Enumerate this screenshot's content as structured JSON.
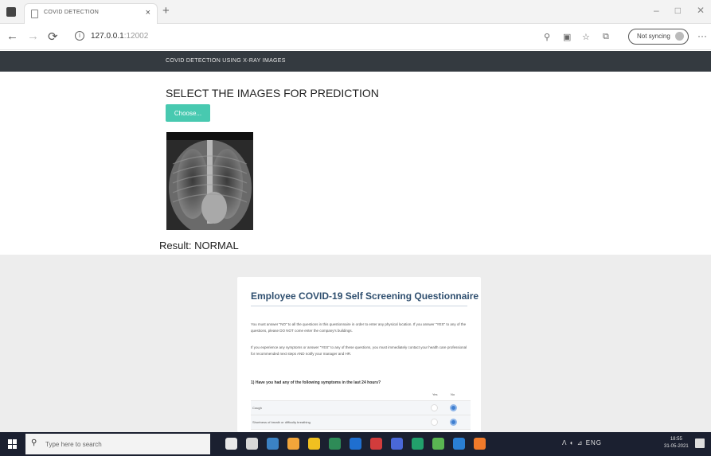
{
  "browser": {
    "tab_title": "COVID DETECTION",
    "tab_close": "×",
    "new_tab": "+",
    "url_host": "127.0.0.1",
    "url_port": ":12002",
    "sync_label": "Not syncing",
    "more": "···",
    "window_controls": [
      "–",
      "□",
      "✕"
    ]
  },
  "header": {
    "title": "COVID DETECTION USING X-RAY IMAGES"
  },
  "main": {
    "heading": "SELECT THE IMAGES FOR PREDICTION",
    "choose_label": "Choose...",
    "result": "Result: NORMAL"
  },
  "questionnaire": {
    "title": "Employee COVID-19 Self Screening Questionnaire",
    "para1": "You must answer \"NO\" to all the questions in this questionnaire in order to enter any physical location. If you answer \"YES\" to any of the questions, please DO NOT come enter the company's buildings.",
    "para2": "If you experience any symptoms or answer \"YES\" to any of these questions, you must immediately contact your health care professional for recommended next steps AND notify your manager and HR.",
    "question": "1) Have you had any of the following symptoms in the last 24 hours?",
    "col_yes": "Yes",
    "col_no": "No",
    "rows": [
      {
        "label": "Cough"
      },
      {
        "label": "Shortness of breath or difficulty breathing"
      }
    ]
  },
  "taskbar": {
    "search_placeholder": "Type here to search",
    "tray": "ENG",
    "clock_time": "18:55",
    "clock_date": "31-05-2021",
    "icon_colors": [
      "#e8e8e8",
      "#d8d8d8",
      "#3b82c4",
      "#f2a53a",
      "#f0c020",
      "#2e8b57",
      "#1f6fd0",
      "#d23c3c",
      "#4a68d8",
      "#22a06b",
      "#5ab552",
      "#2a7fd4",
      "#f07a2a"
    ]
  },
  "accent_color": "#48c9b0"
}
